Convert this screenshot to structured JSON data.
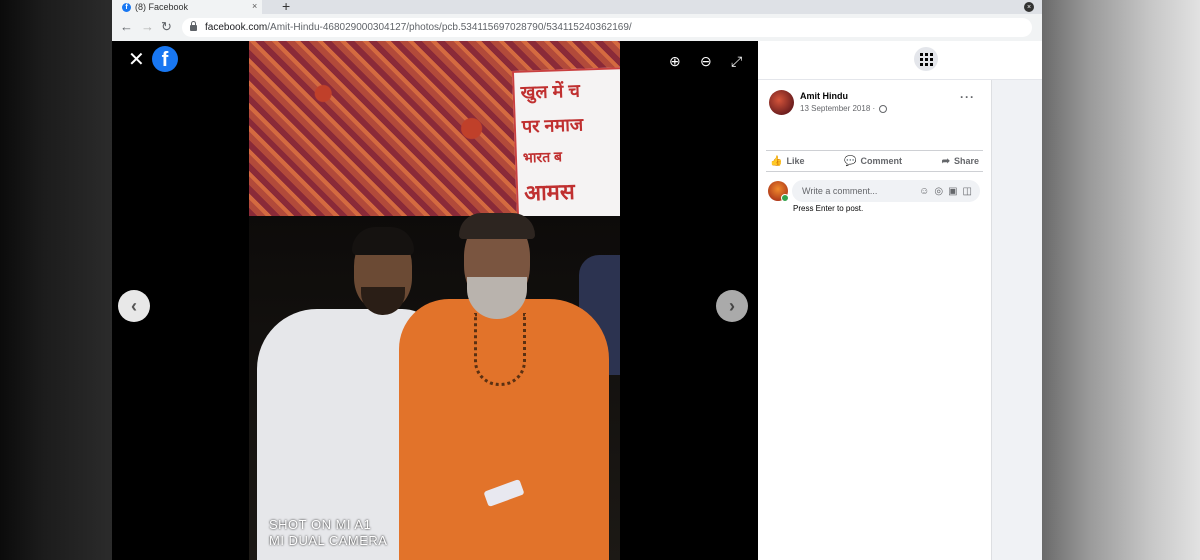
{
  "browser": {
    "tab_title": "(8) Facebook",
    "tab_close": "×",
    "new_tab": "+",
    "url_host": "facebook.com",
    "url_path": "/Amit-Hindu-468029000304127/photos/pcb.534115697028790/534115240362169/"
  },
  "viewer": {
    "close": "✕",
    "logo": "f",
    "zoom_in": "⊕",
    "zoom_out": "⊖",
    "fullscreen": "⤢",
    "prev": "‹",
    "next": "›",
    "photo": {
      "banner_lines": [
        "खुल में च",
        "पर नमाज",
        "भारत ब",
        "आमस"
      ],
      "watermark_line1": "SHOT ON MI A1",
      "watermark_line2": "MI DUAL CAMERA"
    }
  },
  "post": {
    "author": "Amit Hindu",
    "date": "13 September 2018 ·",
    "more": "···",
    "actions": [
      {
        "label": "Like",
        "icon": "thumbs-up-icon",
        "glyph": "👍"
      },
      {
        "label": "Comment",
        "icon": "comment-icon",
        "glyph": "💬"
      },
      {
        "label": "Share",
        "icon": "share-icon",
        "glyph": "➦"
      }
    ],
    "comment_placeholder": "Write a comment...",
    "comment_icons": [
      "☺",
      "◎",
      "▣",
      "◫"
    ],
    "hint": "Press Enter to post."
  }
}
